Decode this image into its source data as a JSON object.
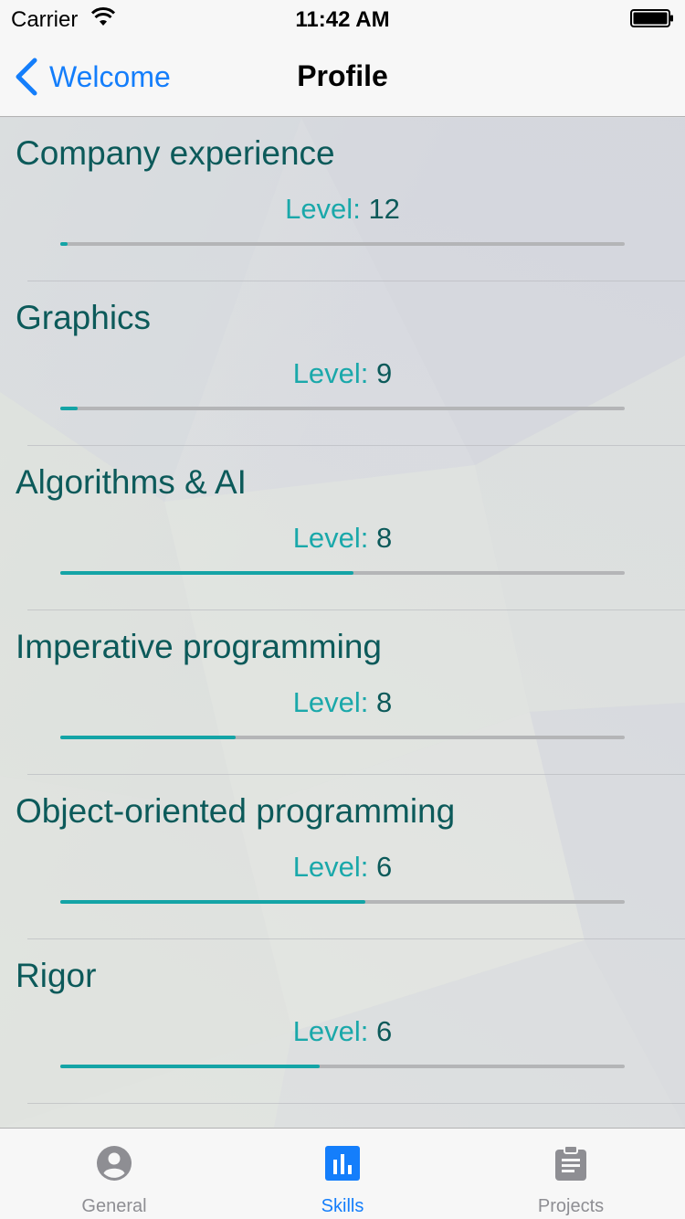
{
  "status_bar": {
    "carrier": "Carrier",
    "time": "11:42 AM"
  },
  "nav": {
    "back_label": "Welcome",
    "title": "Profile"
  },
  "skills": [
    {
      "name": "Company experience",
      "level_label": "Level:",
      "level": "12",
      "progress": 0.013
    },
    {
      "name": "Graphics",
      "level_label": "Level:",
      "level": "9",
      "progress": 0.03
    },
    {
      "name": "Algorithms & AI",
      "level_label": "Level:",
      "level": "8",
      "progress": 0.52
    },
    {
      "name": "Imperative programming",
      "level_label": "Level:",
      "level": "8",
      "progress": 0.31
    },
    {
      "name": "Object-oriented programming",
      "level_label": "Level:",
      "level": "6",
      "progress": 0.54
    },
    {
      "name": "Rigor",
      "level_label": "Level:",
      "level": "6",
      "progress": 0.46
    }
  ],
  "tabs": [
    {
      "label": "General",
      "icon": "person-icon"
    },
    {
      "label": "Skills",
      "icon": "bar-chart-icon"
    },
    {
      "label": "Projects",
      "icon": "clipboard-icon"
    }
  ],
  "active_tab": "Skills",
  "colors": {
    "accent": "#147efb",
    "skill_title": "#0c5a5a",
    "level_label": "#1aa8aa",
    "progress_fill": "#14a4a6",
    "progress_track": "#b4b5b7",
    "tab_inactive": "#8e8e93"
  }
}
